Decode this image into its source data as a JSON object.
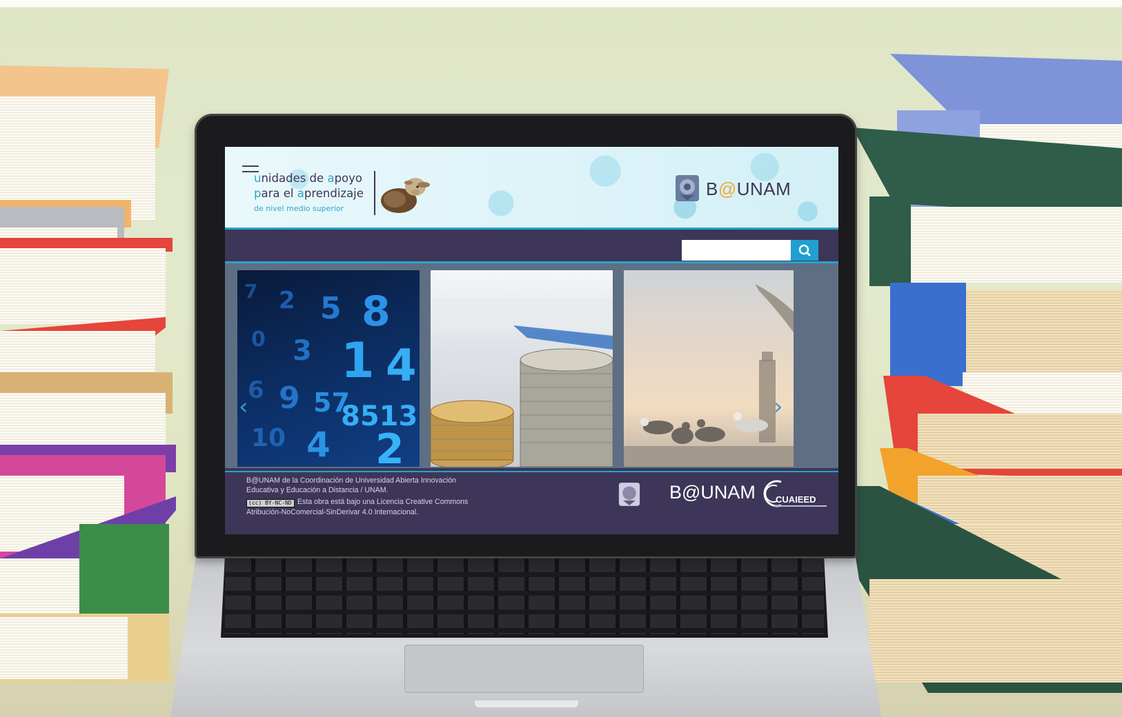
{
  "header": {
    "brand_line1_parts": [
      "u",
      "nidades de ",
      "a",
      "poyo"
    ],
    "brand_line2_parts": [
      "p",
      "ara el ",
      "a",
      "prendizaje"
    ],
    "brand_line3": "de nivel medio superior",
    "logo_left": "B",
    "logo_at": "@",
    "logo_right": "UNAM"
  },
  "search": {
    "placeholder": "",
    "button_icon": "search-icon"
  },
  "carousel": {
    "prev_icon": "chevron-left-icon",
    "next_icon": "chevron-right-icon",
    "prev_glyph": "‹",
    "next_glyph": "›",
    "slides": [
      "numbers-slide",
      "coins-slide",
      "seagulls-slide"
    ],
    "numbers_text": [
      "7",
      "2",
      "5",
      "8",
      "0",
      "3",
      "1",
      "4",
      "6",
      "9",
      "57",
      "8513",
      "10",
      "4",
      "2"
    ]
  },
  "footer": {
    "line1": "B@UNAM de la Coordinación de Universidad Abierta Innovación",
    "line2": "Educativa y Educación a Distancia / UNAM.",
    "cc_badge": "(cc) BY-NC-ND",
    "line3": "Esta obra está bajo una Licencia Creative Commons",
    "line4": "Atribución-NoComercial-SinDerivar 4.0 Internacional.",
    "logo_text": "B@UNAM",
    "cuaieed_text": "CUAIEED"
  },
  "colors": {
    "brand_purple": "#3d3658",
    "accent_blue": "#27a4cd",
    "accent_orange": "#f0a93b"
  }
}
